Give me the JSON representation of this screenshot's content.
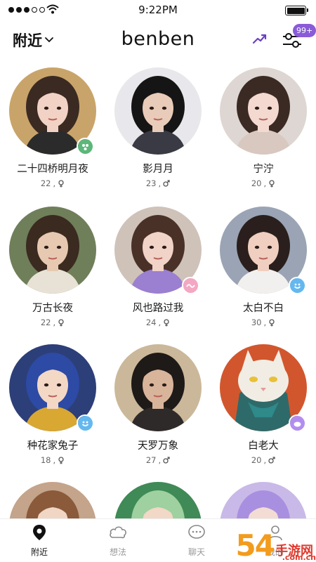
{
  "status_bar": {
    "time": "9:22PM",
    "battery_level": 1.0
  },
  "header": {
    "location_label": "附近",
    "logo": "benben",
    "notification_badge": "99+"
  },
  "icons": {
    "trend": "trending-up-icon",
    "filter": "filter-sliders-icon",
    "female": "female-icon",
    "male": "male-icon"
  },
  "colors": {
    "accent": "#8a5bd8",
    "female": "#555555",
    "male": "#555555"
  },
  "users": [
    {
      "name": "二十四桥明月夜",
      "age": "22",
      "gender": "female",
      "status": "online-green"
    },
    {
      "name": "影月月",
      "age": "23",
      "gender": "male",
      "status": ""
    },
    {
      "name": "宁泞",
      "age": "20",
      "gender": "female",
      "status": ""
    },
    {
      "name": "万古长夜",
      "age": "22",
      "gender": "female",
      "status": ""
    },
    {
      "name": "风也路过我",
      "age": "24",
      "gender": "female",
      "status": "pink-wave"
    },
    {
      "name": "太白不白",
      "age": "30",
      "gender": "female",
      "status": "blue-smile"
    },
    {
      "name": "种花家兔子",
      "age": "18",
      "gender": "female",
      "status": "blue-smile"
    },
    {
      "name": "天罗万象",
      "age": "27",
      "gender": "male",
      "status": ""
    },
    {
      "name": "白老大",
      "age": "20",
      "gender": "male",
      "status": "purple-blob"
    }
  ],
  "tabs": [
    {
      "label": "附近",
      "icon": "location-pin-icon",
      "active": true
    },
    {
      "label": "想法",
      "icon": "cloud-icon",
      "active": false
    },
    {
      "label": "聊天",
      "icon": "chat-bubble-icon",
      "active": false
    },
    {
      "label": "我的",
      "icon": "profile-icon",
      "active": false
    }
  ],
  "watermark": {
    "number": "54",
    "text": "手游网",
    "url": ".com.cn"
  }
}
